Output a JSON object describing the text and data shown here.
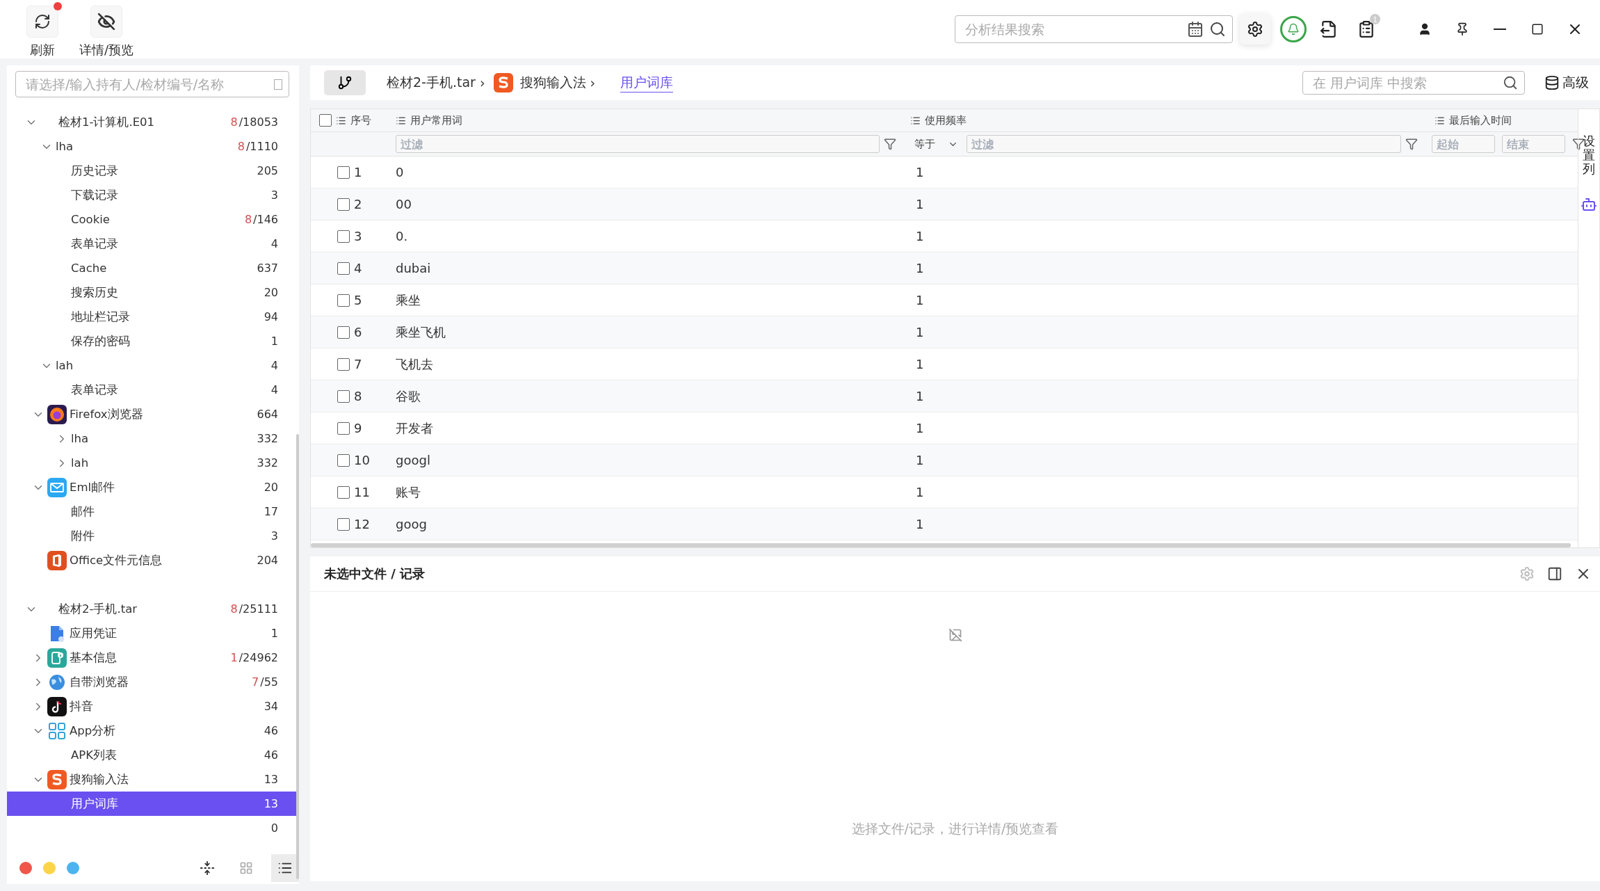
{
  "toolbar": [
    {
      "label": "刷新",
      "badge": true
    },
    {
      "label": "详情/预览",
      "badge": false
    }
  ],
  "global_search": {
    "placeholder": "分析结果搜索"
  },
  "notification_badge": "1",
  "sidebar": {
    "search": {
      "placeholder": "请选择/输入持有人/检材编号/名称"
    },
    "tree": [
      {
        "label": "检材1-计算机.E01",
        "hits": "8",
        "count": "/18053",
        "expanded": true,
        "selected": false,
        "children": [
          {
            "label": "lha",
            "hits": "8",
            "count": "/1110",
            "expanded": true,
            "selected": false,
            "children": [
              {
                "label": "历史记录",
                "count": "205",
                "selected": false
              },
              {
                "label": "下载记录",
                "count": "3",
                "selected": false
              },
              {
                "label": "Cookie",
                "hits": "8",
                "count": "/146",
                "selected": false
              },
              {
                "label": "表单记录",
                "count": "4",
                "selected": false
              },
              {
                "label": "Cache",
                "count": "637",
                "selected": false
              },
              {
                "label": "搜索历史",
                "count": "20",
                "selected": false
              },
              {
                "label": "地址栏记录",
                "count": "94",
                "selected": false
              },
              {
                "label": "保存的密码",
                "count": "1",
                "selected": false
              }
            ]
          },
          {
            "label": "lah",
            "count": "4",
            "expanded": true,
            "selected": false,
            "children": [
              {
                "label": "表单记录",
                "count": "4",
                "selected": false
              }
            ]
          },
          {
            "label": "Firefox浏览器",
            "kind": "firefox",
            "count": "664",
            "expanded": true,
            "selected": false,
            "children": [
              {
                "label": "lha",
                "count": "332",
                "expanded": false,
                "selected": false
              },
              {
                "label": "lah",
                "count": "332",
                "expanded": false,
                "selected": false
              }
            ]
          },
          {
            "label": "Eml邮件",
            "kind": "mail",
            "count": "20",
            "expanded": true,
            "selected": false,
            "children": [
              {
                "label": "邮件",
                "count": "17",
                "selected": false
              },
              {
                "label": "附件",
                "count": "3",
                "selected": false
              }
            ]
          },
          {
            "label": "Office文件元信息",
            "kind": "office",
            "count": "204",
            "selected": false
          }
        ]
      },
      {
        "label": "检材2-手机.tar",
        "hits": "8",
        "count": "/25111",
        "expanded": true,
        "selected": false,
        "children": [
          {
            "label": "应用凭证",
            "kind": "credential",
            "count": "1",
            "selected": false
          },
          {
            "label": "基本信息",
            "kind": "info",
            "hits": "1",
            "count": "/24962",
            "expanded": false,
            "selected": false
          },
          {
            "label": "自带浏览器",
            "kind": "globe",
            "hits": "7",
            "count": "/55",
            "expanded": false,
            "selected": false
          },
          {
            "label": "抖音",
            "kind": "tiktok",
            "count": "34",
            "expanded": false,
            "selected": false
          },
          {
            "label": "App分析",
            "kind": "apps",
            "count": "46",
            "expanded": true,
            "selected": false,
            "children": [
              {
                "label": "APK列表",
                "count": "46",
                "selected": false
              }
            ]
          },
          {
            "label": "搜狗输入法",
            "kind": "sogou",
            "count": "13",
            "expanded": true,
            "selected": false,
            "children": [
              {
                "label": "用户词库",
                "count": "13",
                "selected": true
              }
            ]
          }
        ]
      },
      {
        "count": "0",
        "selected": false
      }
    ],
    "theme_dots": [
      {
        "color": "#f0564a"
      },
      {
        "color": "#fbd448"
      },
      {
        "color": "#4db3f0"
      }
    ],
    "view_buttons": [
      {
        "selected": false
      },
      {
        "selected": true
      }
    ]
  },
  "breadcrumb": {
    "items": [
      {
        "label": "检材2-手机.tar",
        "kind": "plain"
      },
      {
        "label": "搜狗输入法",
        "kind": "sogou"
      }
    ],
    "separator": "›",
    "current": "用户词库"
  },
  "table_search": {
    "placeholder": "在 用户词库 中搜索"
  },
  "advanced_button": "高级",
  "table": {
    "all_checked": false,
    "columns": [
      "序号",
      "用户常用词",
      "使用频率",
      "最后输入时间"
    ],
    "filters": {
      "word": {
        "placeholder": "过滤"
      },
      "operator": "等于",
      "freq": {
        "placeholder": "过滤"
      },
      "start": {
        "placeholder": "起始"
      },
      "end": {
        "placeholder": "结束"
      }
    },
    "rows": [
      {
        "index": "1",
        "word": "0",
        "freq": "1",
        "checked": false
      },
      {
        "index": "2",
        "word": "00",
        "freq": "1",
        "checked": false
      },
      {
        "index": "3",
        "word": "0.",
        "freq": "1",
        "checked": false
      },
      {
        "index": "4",
        "word": "dubai",
        "freq": "1",
        "checked": false
      },
      {
        "index": "5",
        "word": "乘坐",
        "freq": "1",
        "checked": false
      },
      {
        "index": "6",
        "word": "乘坐飞机",
        "freq": "1",
        "checked": false
      },
      {
        "index": "7",
        "word": "飞机去",
        "freq": "1",
        "checked": false
      },
      {
        "index": "8",
        "word": "谷歌",
        "freq": "1",
        "checked": false
      },
      {
        "index": "9",
        "word": "开发者",
        "freq": "1",
        "checked": false
      },
      {
        "index": "10",
        "word": "googl",
        "freq": "1",
        "checked": false
      },
      {
        "index": "11",
        "word": "账号",
        "freq": "1",
        "checked": false
      },
      {
        "index": "12",
        "word": "goog",
        "freq": "1",
        "checked": false
      }
    ]
  },
  "column_settings": "设置列",
  "detail_panel": {
    "title": "未选中文件 / 记录",
    "hint": "选择文件/记录，进行详情/预览查看"
  }
}
